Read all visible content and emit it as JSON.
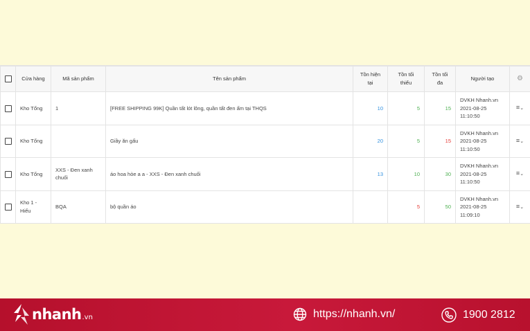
{
  "table": {
    "headers": {
      "store": "Cửa hàng",
      "sku": "Mã sản phẩm",
      "name": "Tên sản phẩm",
      "stock_now_1": "Tồn hiện",
      "stock_now_2": "tại",
      "stock_min_1": "Tồn tối",
      "stock_min_2": "thiểu",
      "stock_max_1": "Tồn tối",
      "stock_max_2": "đa",
      "creator": "Người tạo",
      "settings_icon": "gear-icon"
    },
    "rows": [
      {
        "store": "Kho Tổng",
        "sku": "1",
        "name": "[FREE SHIPPING 99K] Quần tất lót lông, quần tất đen ấm tại THQS",
        "stock_now": "10",
        "stock_min": "5",
        "stock_max": "15",
        "creator": "DVKH Nhanh.vn",
        "date": "2021-08-25",
        "time": "11:10:50"
      },
      {
        "store": "Kho Tổng",
        "sku": "",
        "name": "Giầy ăn gấu",
        "stock_now": "20",
        "stock_min": "5",
        "stock_max": "15",
        "creator": "DVKH Nhanh.vn",
        "date": "2021-08-25",
        "time": "11:10:50"
      },
      {
        "store": "Kho Tổng",
        "sku": "XXS - Đen xanh chuối",
        "name": "áo hoa hòe a a - XXS - Đen xanh chuối",
        "stock_now": "13",
        "stock_min": "10",
        "stock_max": "30",
        "creator": "DVKH Nhanh.vn",
        "date": "2021-08-25",
        "time": "11:10:50"
      },
      {
        "store": "Kho 1 - Hiếu",
        "sku": "BQA",
        "name": "bộ quần áo",
        "stock_now": "",
        "stock_min": "5",
        "stock_max": "50",
        "creator": "DVKH Nhanh.vn",
        "date": "2021-08-25",
        "time": "11:09:10"
      }
    ]
  },
  "footer": {
    "brand": "nhanh",
    "brand_suffix": ".vn",
    "url": "https://nhanh.vn/",
    "phone": "1900 2812"
  },
  "colors": {
    "accent_blue": "#2f8fdf",
    "accent_green": "#4caf50",
    "accent_red": "#e53935",
    "footer_red": "#c8193a",
    "background": "#fdfad9"
  }
}
